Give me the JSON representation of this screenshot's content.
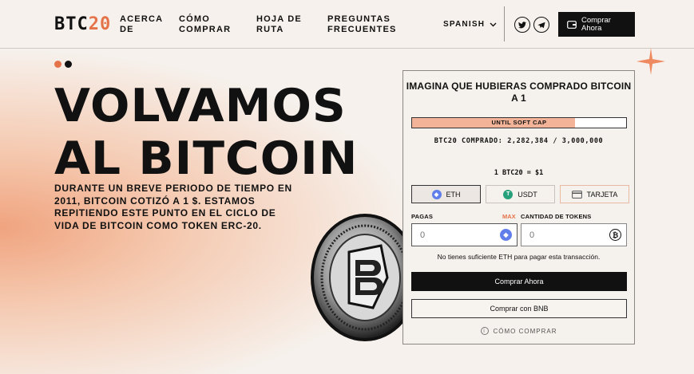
{
  "header": {
    "logo_text": "BTC",
    "logo_num": "20",
    "nav": [
      "ACERCA DE",
      "CÓMO COMPRAR",
      "HOJA DE RUTA",
      "PREGUNTAS FRECUENTES"
    ],
    "language": "SPANISH",
    "buy_label": "Comprar Ahora"
  },
  "hero": {
    "title_line1": "VOLVAMOS",
    "title_line2": "AL BITCOIN",
    "subtitle": "DURANTE UN BREVE PERIODO DE TIEMPO EN 2011, BITCOIN COTIZÓ A 1 $. ESTAMOS REPITIENDO ESTE PUNTO EN EL CICLO DE VIDA DE BITCOIN COMO TOKEN ERC-20."
  },
  "widget": {
    "title": "IMAGINA QUE HUBIERAS COMPRADO BITCOIN A 1",
    "progress_label": "UNTIL SOFT CAP",
    "progress_fraction": 0.76,
    "sold_text": "BTC20 COMPRADO: 2,282,384 / 3,000,000",
    "rate_text": "1 BTC20 = $1",
    "tabs": [
      "ETH",
      "USDT",
      "TARJETA"
    ],
    "pay_label": "PAGAS",
    "max_label": "MAX",
    "receive_label": "CANTIDAD DE TOKENS",
    "pay_placeholder": "0",
    "receive_placeholder": "0",
    "warning": "No tienes suficiente ETH para pagar esta transacción.",
    "buy_button": "Comprar Ahora",
    "bnb_button": "Comprar con BNB",
    "how_to": "CÓMO COMPRAR"
  },
  "colors": {
    "accent": "#e5734a",
    "eth": "#627eea",
    "usdt": "#26a17b",
    "dark": "#111111"
  },
  "icons": [
    "chevron-down-icon",
    "twitter-icon",
    "telegram-icon",
    "wallet-icon",
    "eth-icon",
    "usdt-icon",
    "card-icon",
    "bitcoin-icon",
    "info-icon",
    "sparkle-star-icon",
    "coin-image"
  ]
}
